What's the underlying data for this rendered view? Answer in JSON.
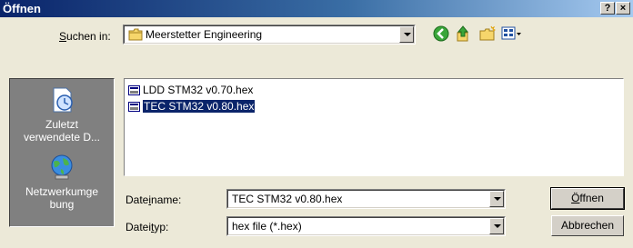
{
  "window": {
    "title": "Öffnen",
    "help_label": "?",
    "close_label": "×"
  },
  "lookin": {
    "label_pre": "",
    "label_key": "S",
    "label_post": "uchen in:",
    "value": "Meerstetter Engineering"
  },
  "places": [
    {
      "line1": "Zuletzt",
      "line2": "verwendete D...",
      "icon": "recent-documents-icon"
    },
    {
      "line1": "Netzwerkumge",
      "line2": "bung",
      "icon": "network-globe-icon"
    }
  ],
  "files": [
    {
      "name": "LDD STM32 v0.70.hex",
      "selected": false
    },
    {
      "name": "TEC STM32 v0.80.hex",
      "selected": true
    }
  ],
  "filename": {
    "label_pre": "Date",
    "label_key": "i",
    "label_post": "name:",
    "value": "TEC STM32 v0.80.hex"
  },
  "filetype": {
    "label_pre": "Datei",
    "label_key": "t",
    "label_post": "yp:",
    "value": "hex file (*.hex)"
  },
  "buttons": {
    "open_key": "Ö",
    "open_rest": "ffnen",
    "cancel": "Abbrechen"
  },
  "colors": {
    "title_start": "#0a246a",
    "title_end": "#a6caf0",
    "selection": "#0a246a",
    "places_bg": "#808080"
  }
}
